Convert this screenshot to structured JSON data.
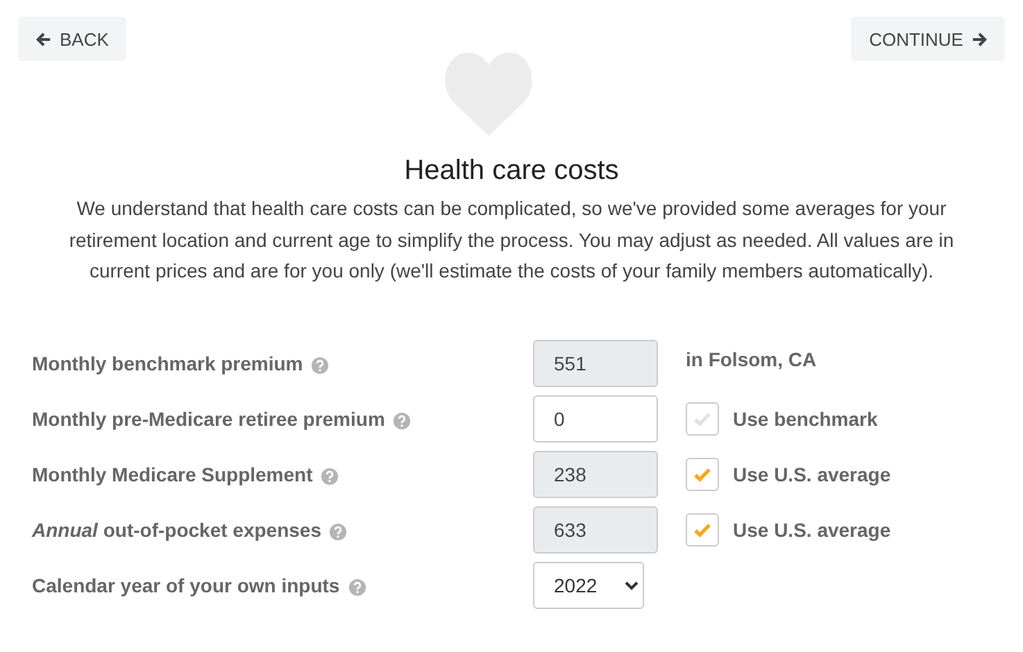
{
  "nav": {
    "back": "BACK",
    "continue": "CONTINUE"
  },
  "title": "Health care costs",
  "intro": "We understand that health care costs can be complicated, so we've provided some averages for your retirement location and current age to simplify the process. You may adjust as needed. All values are in current prices and are for you only (we'll estimate the costs of your family members automatically).",
  "rows": [
    {
      "label": "Monthly benchmark premium",
      "field": {
        "kind": "input",
        "value": "551",
        "disabled": true
      },
      "side": {
        "kind": "text",
        "text": "in Folsom, CA"
      }
    },
    {
      "label": "Monthly pre-Medicare retiree premium",
      "field": {
        "kind": "input",
        "value": "0",
        "disabled": false
      },
      "side": {
        "kind": "checkbox",
        "label": "Use benchmark",
        "checked": false
      }
    },
    {
      "label": "Monthly Medicare Supplement",
      "field": {
        "kind": "input",
        "value": "238",
        "disabled": true
      },
      "side": {
        "kind": "checkbox",
        "label": "Use U.S. average",
        "checked": true
      }
    },
    {
      "label": "*Annual* out-of-pocket expenses",
      "field": {
        "kind": "input",
        "value": "633",
        "disabled": true
      },
      "side": {
        "kind": "checkbox",
        "label": "Use U.S. average",
        "checked": true
      }
    },
    {
      "label": "Calendar year of your own inputs",
      "field": {
        "kind": "select",
        "value": "2022"
      }
    }
  ]
}
